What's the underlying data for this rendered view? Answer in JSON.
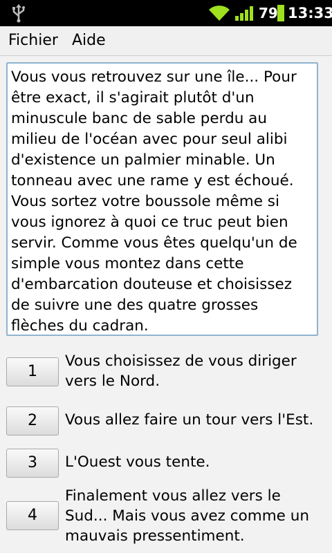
{
  "status_bar": {
    "battery_percent": "79",
    "time": "13:33",
    "icons": [
      "usb-icon",
      "wifi-icon",
      "signal-icon",
      "battery-icon"
    ]
  },
  "menu": {
    "file": "Fichier",
    "help": "Aide"
  },
  "story": {
    "text": "Vous vous retrouvez sur une île... Pour être exact, il s'agirait plutôt d'un minuscule banc de sable perdu au milieu de l'océan avec pour seul alibi d'existence un palmier minable. Un tonneau avec une rame y est échoué. Vous sortez votre boussole même si vous ignorez à quoi ce truc peut bien servir. Comme vous êtes quelqu'un de simple vous montez dans cette d'embarcation douteuse et choisissez de suivre une des quatre grosses flèches du cadran."
  },
  "choices": [
    {
      "number": "1",
      "label": "Vous choisissez de vous diriger vers le Nord."
    },
    {
      "number": "2",
      "label": "Vous allez faire un tour vers l'Est."
    },
    {
      "number": "3",
      "label": "L'Ouest vous tente."
    },
    {
      "number": "4",
      "label": "Finalement vous allez vers le Sud... Mais vous avez comme un mauvais pressentiment."
    }
  ]
}
